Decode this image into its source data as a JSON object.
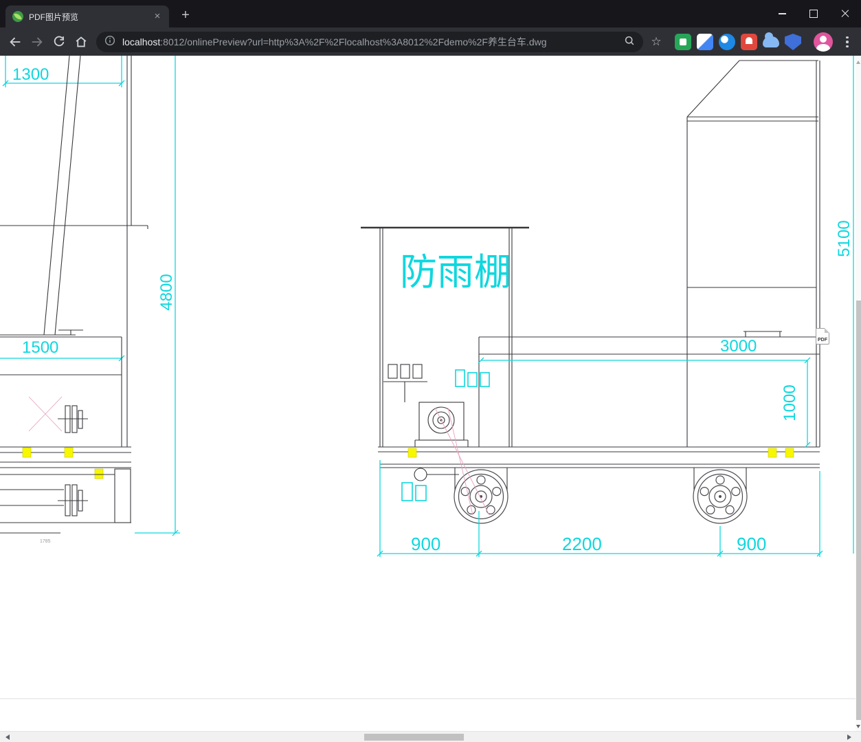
{
  "browser": {
    "tab_title": "PDF图片预览",
    "url_host": "localhost",
    "url_rest": ":8012/onlinePreview?url=http%3A%2F%2Flocalhost%3A8012%2Fdemo%2F养生台车.dwg"
  },
  "icons": {
    "tab_close": "×",
    "new_tab": "+",
    "star": "☆"
  },
  "drawing": {
    "labels": {
      "d1300": "1300",
      "d4800": "4800",
      "d1500": "1500",
      "shelter": "防雨棚",
      "d5100": "5100",
      "d3000": "3000",
      "d1000": "1000",
      "d900_left": "900",
      "d2200": "2200",
      "d900_right": "900",
      "note_1785": "1785"
    },
    "pdf_badge": "PDF"
  },
  "colors": {
    "cyan": "#0fd7de",
    "yellow": "#f7f700",
    "pink": "#e8a2be",
    "line": "#38383c"
  }
}
